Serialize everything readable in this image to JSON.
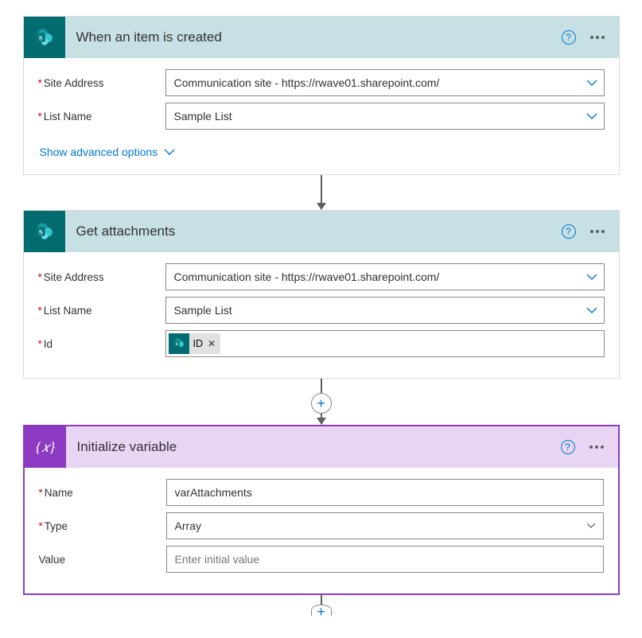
{
  "steps": [
    {
      "icon": "sharepoint",
      "iconBg": "teal",
      "title": "When an item is created",
      "fields": [
        {
          "label": "Site Address",
          "required": true,
          "value": "Communication site - https://rwave01.sharepoint.com/",
          "type": "combo-blue"
        },
        {
          "label": "List Name",
          "required": true,
          "value": "Sample List",
          "type": "combo-blue"
        }
      ],
      "advancedLink": "Show advanced options"
    },
    {
      "icon": "sharepoint",
      "iconBg": "teal",
      "title": "Get attachments",
      "fields": [
        {
          "label": "Site Address",
          "required": true,
          "value": "Communication site - https://rwave01.sharepoint.com/",
          "type": "combo-blue"
        },
        {
          "label": "List Name",
          "required": true,
          "value": "Sample List",
          "type": "combo-blue"
        },
        {
          "label": "Id",
          "required": true,
          "type": "token",
          "tokenLabel": "ID"
        }
      ]
    },
    {
      "icon": "variable",
      "iconBg": "purple",
      "title": "Initialize variable",
      "fields": [
        {
          "label": "Name",
          "required": true,
          "value": "varAttachments",
          "type": "text"
        },
        {
          "label": "Type",
          "required": true,
          "value": "Array",
          "type": "combo-grey"
        },
        {
          "label": "Value",
          "required": false,
          "placeholder": "Enter initial value",
          "type": "text"
        }
      ]
    }
  ]
}
